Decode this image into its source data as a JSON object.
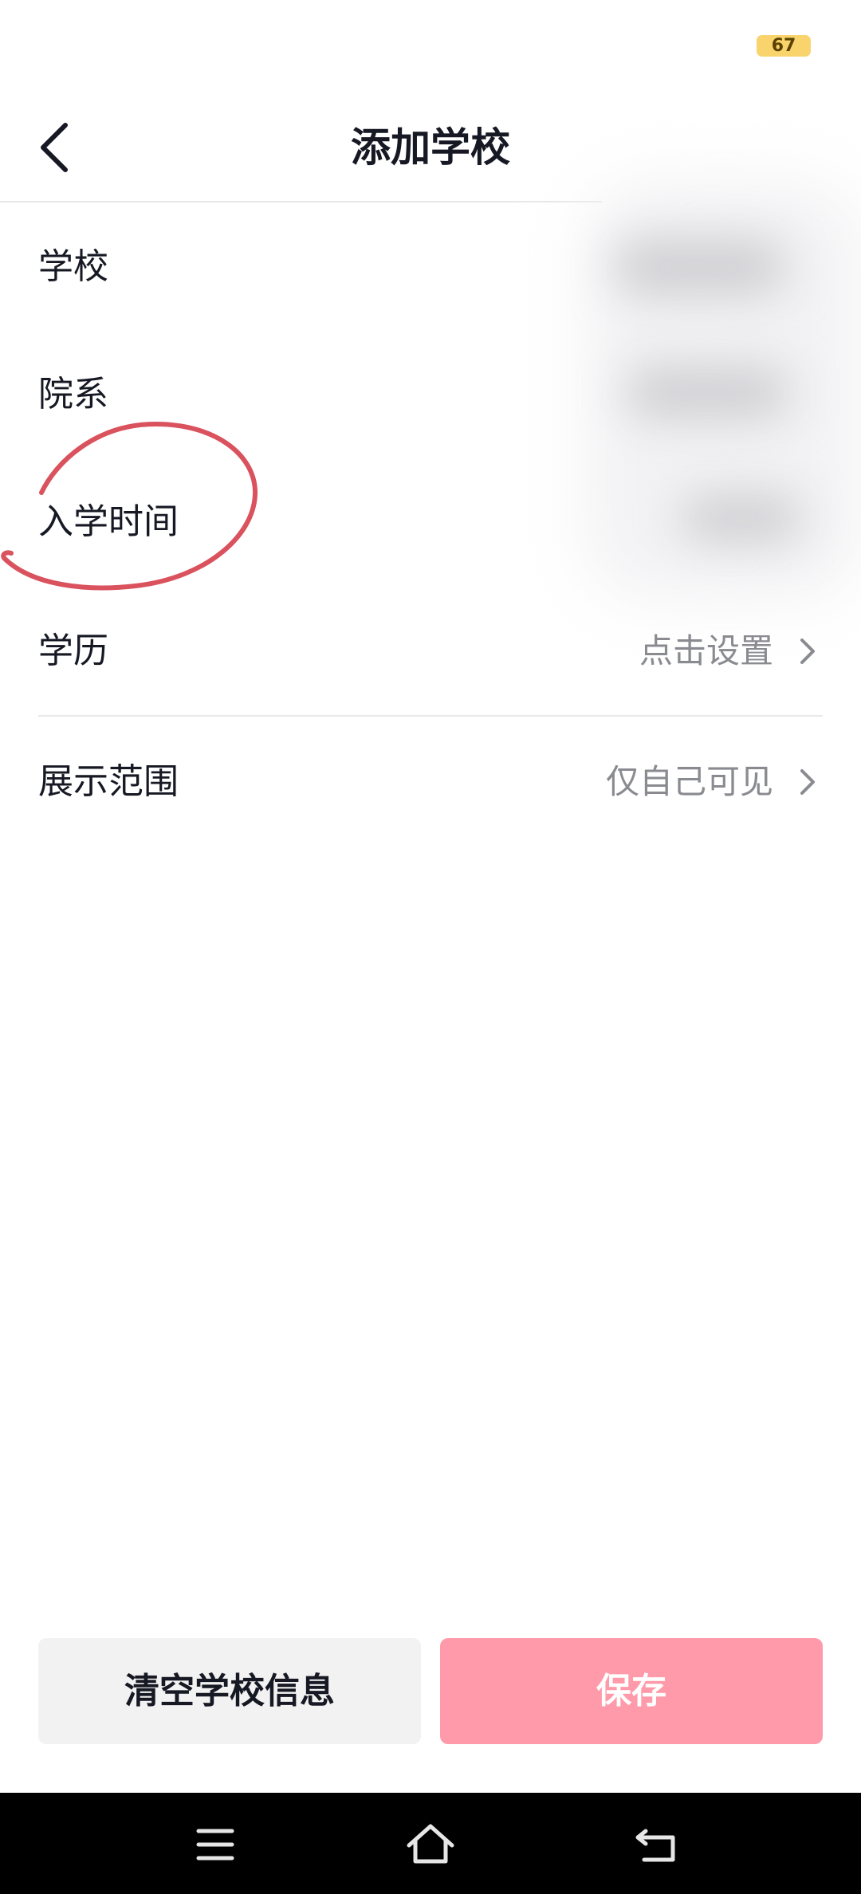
{
  "status_bar": {
    "battery_level": "67",
    "battery_color": "#f9d36b"
  },
  "header": {
    "title": "添加学校",
    "back_icon": "chevron-left-icon"
  },
  "form": {
    "rows": [
      {
        "label": "学校",
        "value": ""
      },
      {
        "label": "院系",
        "value": ""
      },
      {
        "label": "入学时间",
        "value": ""
      },
      {
        "label": "学历",
        "value": "点击设置"
      },
      {
        "label": "展示范围",
        "value": "仅自己可见"
      }
    ]
  },
  "annotation": {
    "color": "#d9525e",
    "circled_field": "入学时间"
  },
  "actions": {
    "clear_label": "清空学校信息",
    "save_label": "保存",
    "save_color": "#ff9aaa"
  },
  "system_nav": {
    "menu_icon": "menu-icon",
    "home_icon": "home-icon",
    "back_icon": "back-icon"
  }
}
